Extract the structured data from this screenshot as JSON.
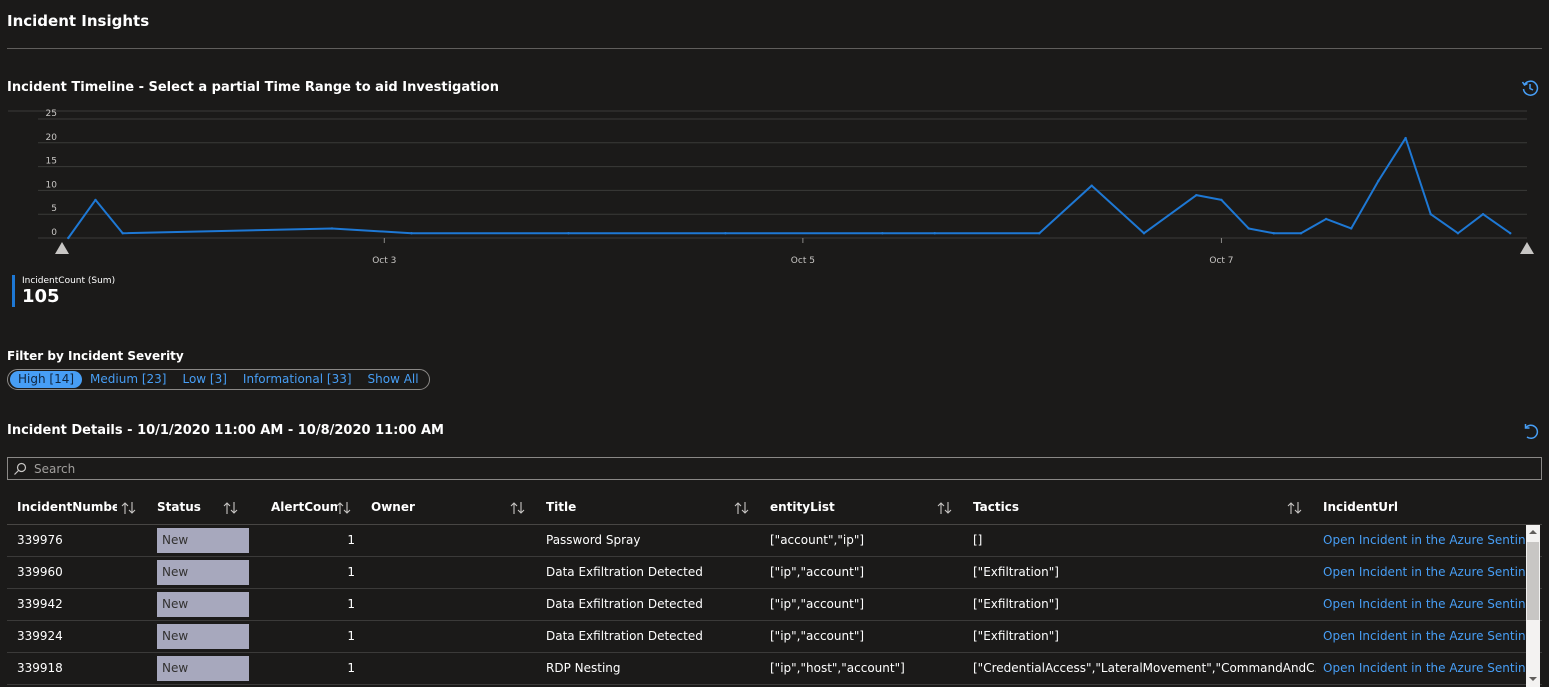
{
  "page": {
    "title": "Incident Insights"
  },
  "timeline": {
    "title": "Incident Timeline - Select a partial Time Range to aid Investigation",
    "history_icon": "history-icon",
    "legend_name": "IncidentCount (Sum)",
    "legend_total": "105",
    "series_color": "#1e78d4"
  },
  "chart_data": {
    "type": "line",
    "title": "",
    "xlabel": "",
    "ylabel": "",
    "ylim": [
      0,
      25
    ],
    "yticks": [
      "0",
      "5",
      "10",
      "15",
      "20",
      "25"
    ],
    "xtick_labels": [
      {
        "label": "Oct 3",
        "day": 3
      },
      {
        "label": "Oct 5",
        "day": 5
      },
      {
        "label": "Oct 7",
        "day": 7
      }
    ],
    "x_range_days": [
      1.46,
      8.46
    ],
    "series": [
      {
        "name": "IncidentCount (Sum)",
        "x_days": [
          1.49,
          1.62,
          1.75,
          2.75,
          3.13,
          3.88,
          4.63,
          5.38,
          5.63,
          6.13,
          6.38,
          6.63,
          6.88,
          7.0,
          7.13,
          7.25,
          7.38,
          7.5,
          7.62,
          7.75,
          7.88,
          8.0,
          8.13,
          8.25,
          8.38
        ],
        "values": [
          0,
          8,
          1,
          2,
          1,
          1,
          1,
          1,
          1,
          1,
          11,
          1,
          9,
          8,
          2,
          1,
          1,
          4,
          2,
          12,
          21,
          5,
          1,
          5,
          1
        ]
      }
    ]
  },
  "filter": {
    "label": "Filter by Incident Severity",
    "options": [
      {
        "label": "High [14]",
        "selected": true
      },
      {
        "label": "Medium [23]",
        "selected": false
      },
      {
        "label": "Low [3]",
        "selected": false
      },
      {
        "label": "Informational [33]",
        "selected": false
      },
      {
        "label": "Show All",
        "selected": false
      }
    ]
  },
  "details": {
    "title": "Incident Details - 10/1/2020 11:00 AM - 10/8/2020 11:00 AM",
    "reset_icon": "undo-icon",
    "search_placeholder": "Search",
    "columns": [
      "IncidentNumber",
      "Status",
      "AlertCount",
      "Owner",
      "Title",
      "entityList",
      "Tactics",
      "IncidentUrl"
    ],
    "rows": [
      {
        "number": "339976",
        "status": "New",
        "alerts": "1",
        "owner": "",
        "title": "Password Spray",
        "entities": "[\"account\",\"ip\"]",
        "tactics": "[]",
        "url": "Open Incident in the Azure Sentinel"
      },
      {
        "number": "339960",
        "status": "New",
        "alerts": "1",
        "owner": "",
        "title": "Data Exfiltration Detected",
        "entities": "[\"ip\",\"account\"]",
        "tactics": "[\"Exfiltration\"]",
        "url": "Open Incident in the Azure Sentinel"
      },
      {
        "number": "339942",
        "status": "New",
        "alerts": "1",
        "owner": "",
        "title": "Data Exfiltration Detected",
        "entities": "[\"ip\",\"account\"]",
        "tactics": "[\"Exfiltration\"]",
        "url": "Open Incident in the Azure Sentinel"
      },
      {
        "number": "339924",
        "status": "New",
        "alerts": "1",
        "owner": "",
        "title": "Data Exfiltration Detected",
        "entities": "[\"ip\",\"account\"]",
        "tactics": "[\"Exfiltration\"]",
        "url": "Open Incident in the Azure Sentinel"
      },
      {
        "number": "339918",
        "status": "New",
        "alerts": "1",
        "owner": "",
        "title": "RDP Nesting",
        "entities": "[\"ip\",\"host\",\"account\"]",
        "tactics": "[\"CredentialAccess\",\"LateralMovement\",\"CommandAndC...",
        "url": "Open Incident in the Azure Sentinel"
      }
    ]
  }
}
